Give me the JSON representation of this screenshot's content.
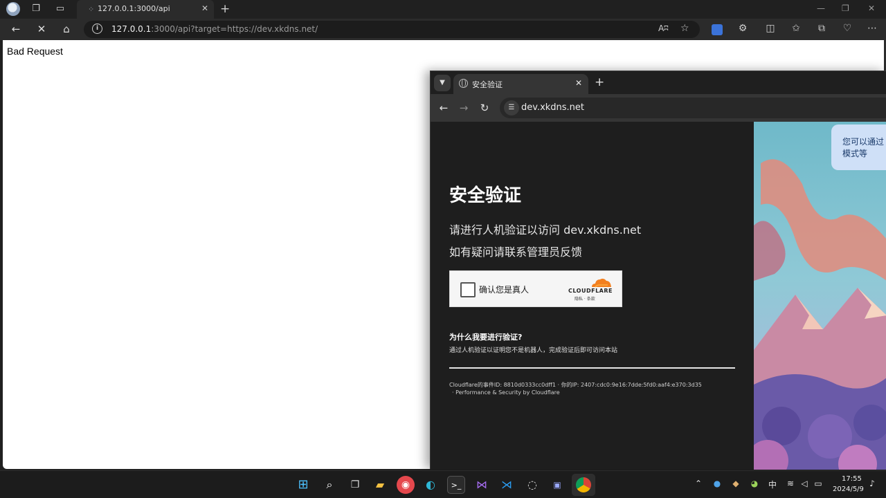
{
  "edge": {
    "tab_title": "127.0.0.1:3000/api",
    "url_host": "127.0.0.1",
    "url_rest": ":3000/api?target=https://dev.xkdns.net/",
    "read_aloud": "Aʭ",
    "page_text": "Bad Request"
  },
  "chrome": {
    "tab_title": "安全验证",
    "omnibox_url": "dev.xkdns.net"
  },
  "challenge": {
    "title": "安全验证",
    "subtitle1": "请进行人机验证以访问 dev.xkdns.net",
    "subtitle2": "如有疑问请联系管理员反馈",
    "checkbox_label": "确认您是真人",
    "cf_wordmark": "CLOUDFLARE",
    "cf_links": "隐私  ·  条款",
    "why_heading": "为什么我要进行验证?",
    "why_text": "通过人机验证以证明您不是机器人，完成验证后即可访问本站",
    "footer1": "Cloudflare的事件ID: 8810d0333cc0dff1  · 你的IP: 2407:cdc0:9e16:7dde:5fd0:aaf4:e370:3d35",
    "footer2": "·  Performance & Security by Cloudflare",
    "tooltip_line1": "您可以通过",
    "tooltip_line2": "模式等"
  },
  "taskbar": {
    "ime": "中",
    "time": "17:55",
    "date": "2024/5/9"
  },
  "colors": {
    "cloudflare_orange": "#f38020",
    "edge_chrome": "#2b2b2b",
    "cf_background": "#1e1e1e"
  }
}
